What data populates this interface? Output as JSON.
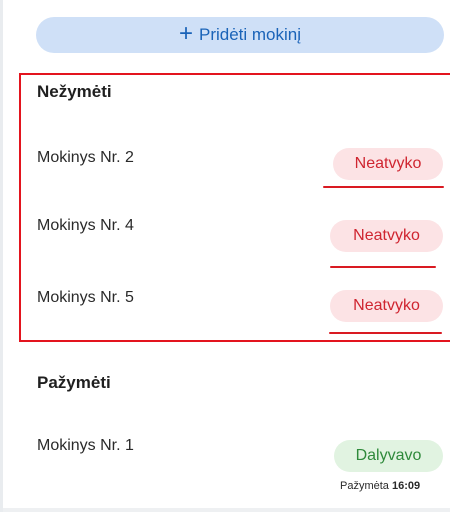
{
  "add_button": {
    "icon": "+",
    "label": "Pridėti mokinį"
  },
  "unmarked": {
    "title": "Nežymėti",
    "students": [
      {
        "name": "Mokinys Nr. 2",
        "status": "Neatvyko"
      },
      {
        "name": "Mokinys Nr. 4",
        "status": "Neatvyko"
      },
      {
        "name": "Mokinys Nr. 5",
        "status": "Neatvyko"
      }
    ]
  },
  "marked": {
    "title": "Pažymėti",
    "students": [
      {
        "name": "Mokinys Nr. 1",
        "status": "Dalyvavo",
        "marked_label": "Pažymėta",
        "marked_time": "16:09"
      }
    ]
  },
  "colors": {
    "absent_badge_bg": "#fce3e5",
    "absent_badge_text": "#cf2530",
    "present_badge_bg": "#e1f3e1",
    "present_badge_text": "#2f8a3b",
    "add_button_bg": "#cfe0f7",
    "add_button_text": "#1a63b8",
    "highlight_annotation": "#e3141e"
  }
}
